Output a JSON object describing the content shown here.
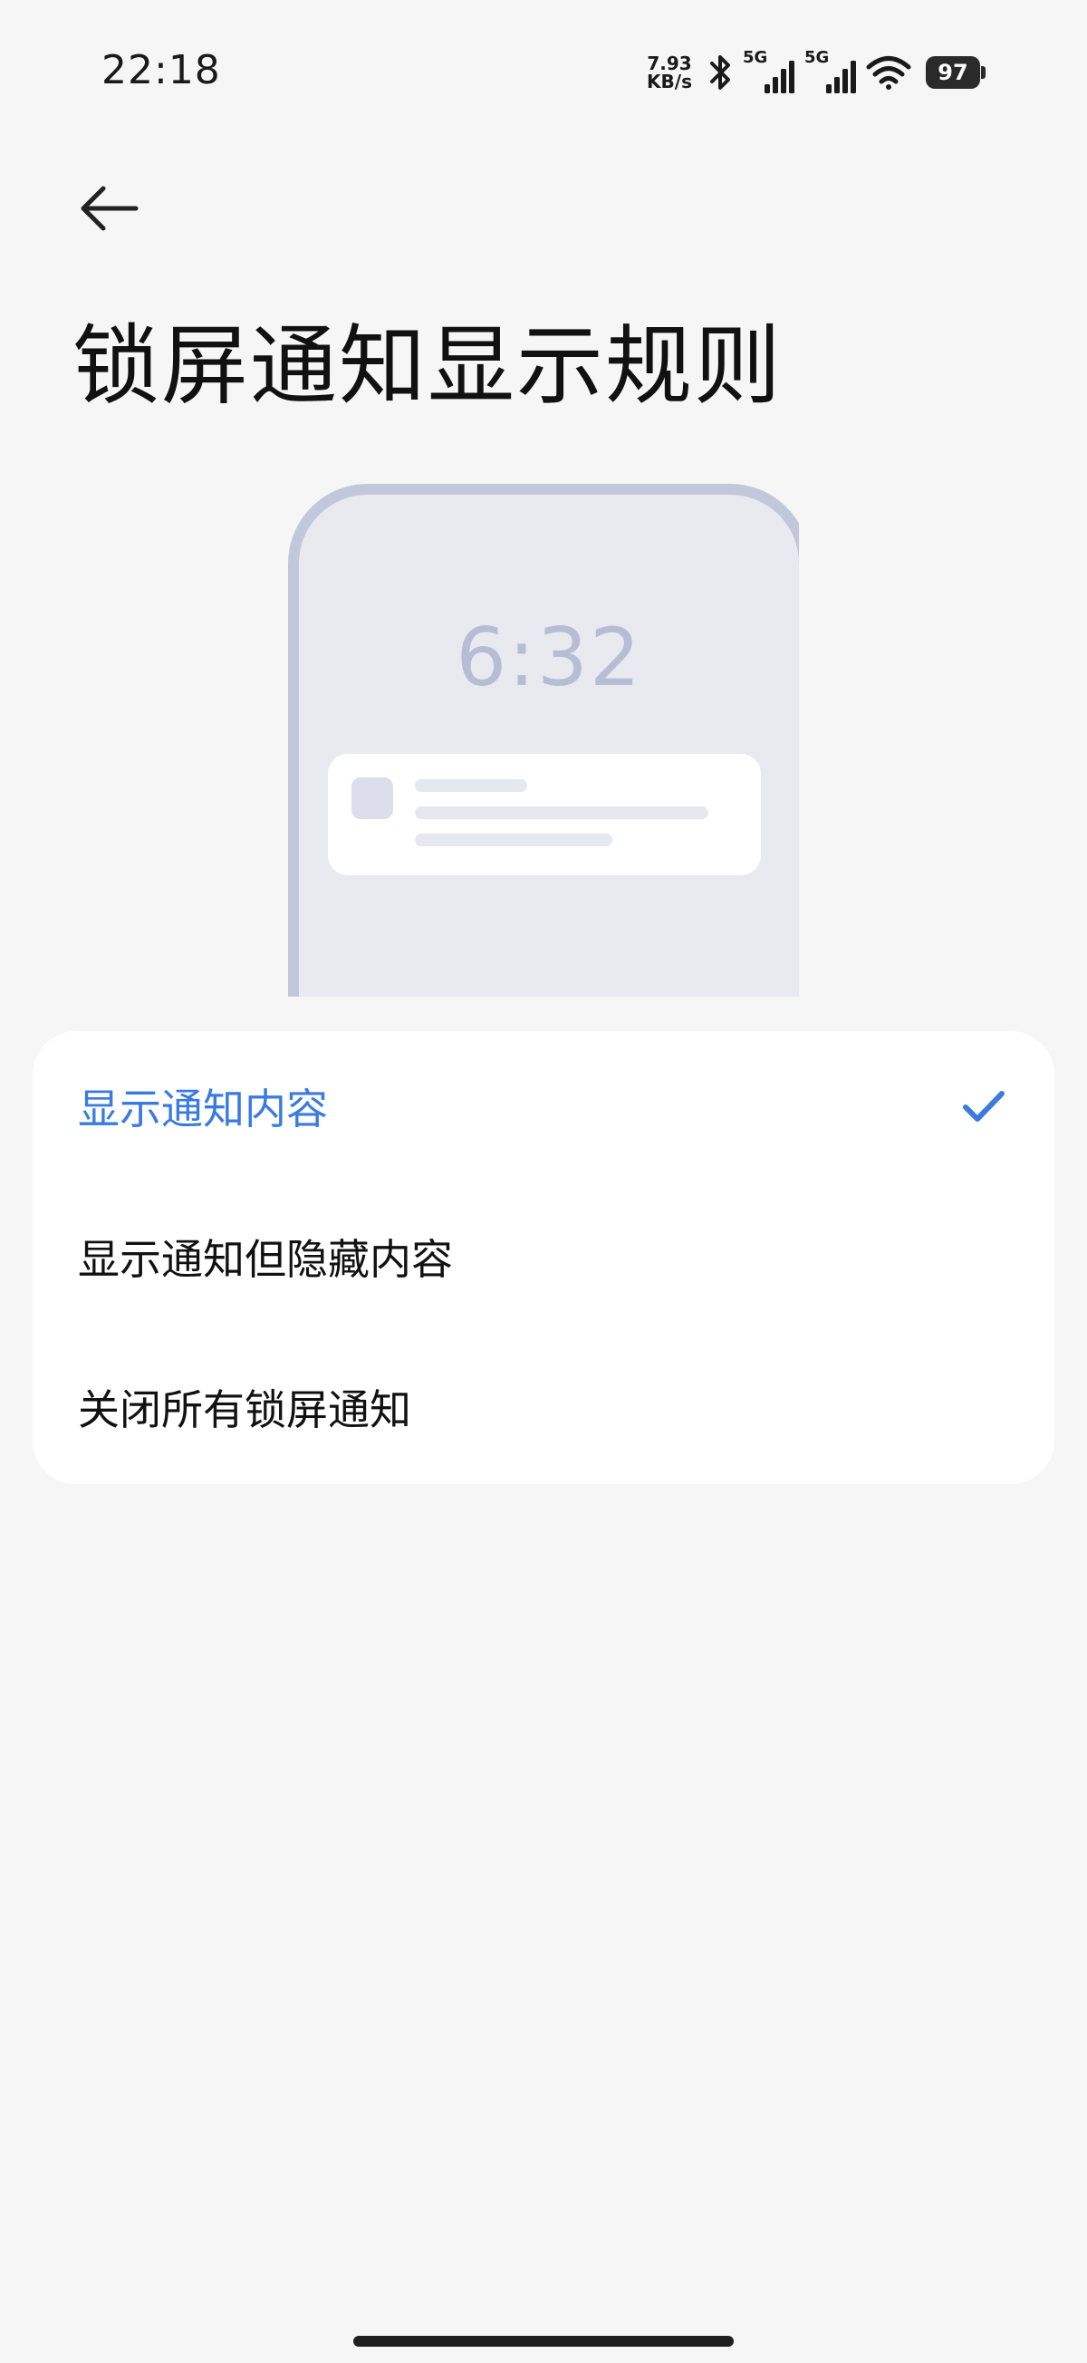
{
  "status_bar": {
    "time": "22:18",
    "net_speed_value": "7.93",
    "net_speed_unit": "KB/s",
    "sim1_network": "5G",
    "sim2_network": "5G",
    "battery_level": "97",
    "icons": [
      "bluetooth-icon",
      "signal-icon",
      "signal-icon",
      "wifi-icon",
      "battery-icon"
    ]
  },
  "header": {
    "back_icon": "back-arrow-icon",
    "title": "锁屏通知显示规则"
  },
  "illustration": {
    "clock": "6:32"
  },
  "options": {
    "items": [
      {
        "label": "显示通知内容",
        "selected": true
      },
      {
        "label": "显示通知但隐藏内容",
        "selected": false
      },
      {
        "label": "关闭所有锁屏通知",
        "selected": false
      }
    ],
    "selected_icon": "checkmark-icon"
  },
  "colors": {
    "accent": "#3a7be0",
    "background": "#f6f6f6",
    "card": "#ffffff",
    "illustration_frame": "#c2c8dc"
  }
}
